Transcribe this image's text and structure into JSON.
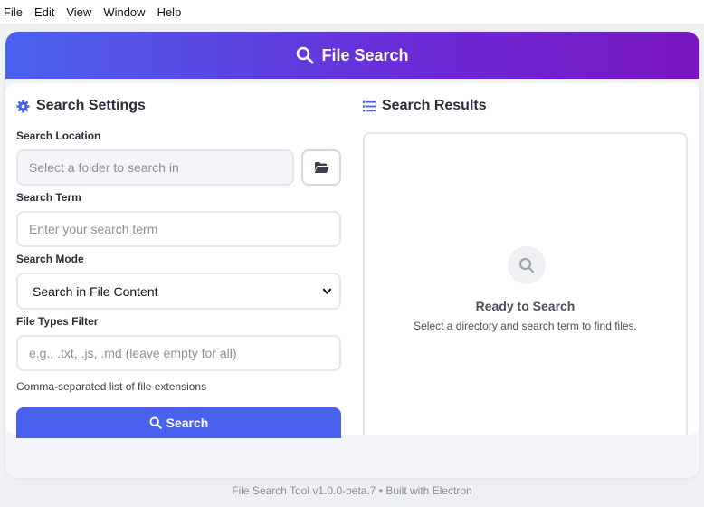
{
  "menu": {
    "items": [
      "File",
      "Edit",
      "View",
      "Window",
      "Help"
    ]
  },
  "header": {
    "title": "File Search",
    "icon": "search-icon"
  },
  "settings": {
    "title": "Search Settings",
    "icon": "gear-icon",
    "location": {
      "label": "Search Location",
      "placeholder": "Select a folder to search in",
      "browse_icon": "folder-open-icon"
    },
    "term": {
      "label": "Search Term",
      "placeholder": "Enter your search term"
    },
    "mode": {
      "label": "Search Mode",
      "selected": "Search in File Content"
    },
    "filetypes": {
      "label": "File Types Filter",
      "placeholder": "e.g., .txt, .js, .md (leave empty for all)",
      "hint": "Comma-separated list of file extensions"
    },
    "search_button": "Search"
  },
  "results": {
    "title": "Search Results",
    "icon": "list-icon",
    "empty_title": "Ready to Search",
    "empty_subtitle": "Select a directory and search term to find files."
  },
  "footer": {
    "text": "File Search Tool v1.0.0-beta.7 • Built with Electron"
  },
  "colors": {
    "accent": "#4a60ee",
    "header_start": "#4a63ee",
    "header_end": "#7a16c0"
  }
}
